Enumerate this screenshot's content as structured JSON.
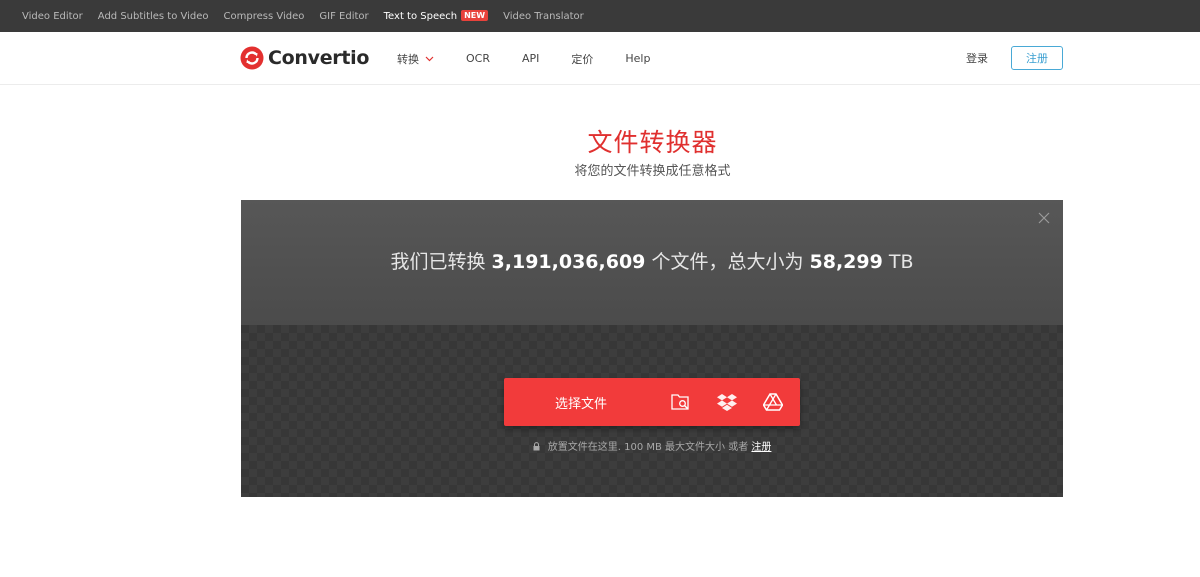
{
  "topbar": {
    "links": [
      {
        "label": "Video Editor"
      },
      {
        "label": "Add Subtitles to Video"
      },
      {
        "label": "Compress Video"
      },
      {
        "label": "GIF Editor"
      },
      {
        "label": "Text to Speech",
        "badge": "NEW"
      },
      {
        "label": "Video Translator"
      }
    ]
  },
  "header": {
    "logo_text": "Convertio",
    "nav": [
      {
        "label": "转换"
      },
      {
        "label": "OCR"
      },
      {
        "label": "API"
      },
      {
        "label": "定价"
      },
      {
        "label": "Help"
      }
    ],
    "login_label": "登录",
    "register_label": "注册"
  },
  "hero": {
    "title": "文件转换器",
    "subtitle": "将您的文件转换成任意格式"
  },
  "panel": {
    "stats_prefix": "我们已转换",
    "files_count": "3,191,036,609",
    "stats_middle": "个文件，总大小为",
    "total_size": "58,299",
    "size_unit": "TB",
    "choose_file_label": "选择文件",
    "drop_hint_text": "放置文件在这里. 100 MB 最大文件大小 或者",
    "drop_hint_link": "注册"
  },
  "colors": {
    "brand_red": "#f23b3b",
    "title_red": "#e0302f",
    "register_blue": "#3a9fd1",
    "topbar_bg": "#3a3a3a"
  },
  "icons": [
    "close-icon",
    "chevron-down-icon",
    "folder-search-icon",
    "dropbox-icon",
    "google-drive-icon",
    "lock-icon"
  ]
}
